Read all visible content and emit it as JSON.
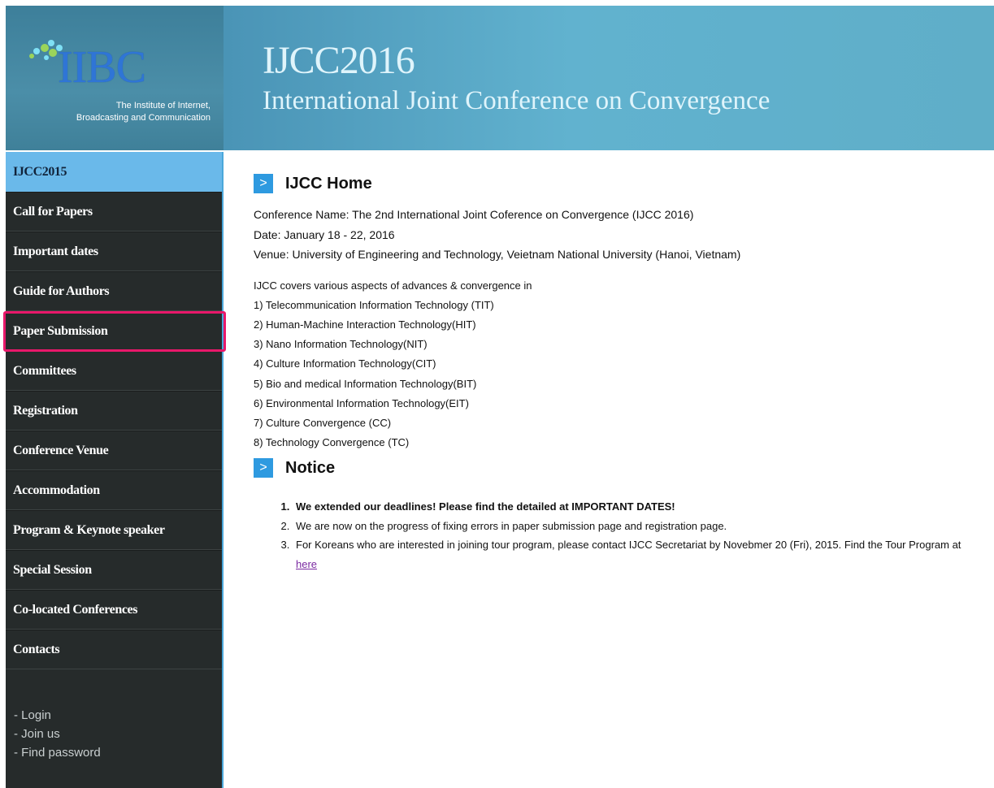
{
  "logo": {
    "name": "IIBC",
    "subtitle_line1": "The Institute of Internet,",
    "subtitle_line2": "Broadcasting and Communication"
  },
  "banner": {
    "title": "IJCC2016",
    "subtitle": "International Joint Conference on Convergence"
  },
  "sidebar": {
    "items": [
      {
        "label": "IJCC2015"
      },
      {
        "label": "Call for Papers"
      },
      {
        "label": "Important dates"
      },
      {
        "label": "Guide for Authors"
      },
      {
        "label": "Paper Submission"
      },
      {
        "label": "Committees"
      },
      {
        "label": "Registration"
      },
      {
        "label": "Conference Venue"
      },
      {
        "label": "Accommodation"
      },
      {
        "label": "Program & Keynote speaker"
      },
      {
        "label": "Special Session"
      },
      {
        "label": "Co-located Conferences"
      },
      {
        "label": "Contacts"
      }
    ],
    "account": {
      "login": "- Login",
      "join": "- Join us",
      "find_password": "- Find password"
    }
  },
  "main": {
    "home_title": "IJCC Home",
    "conference_name": "Conference Name: The 2nd International Joint Coference on Convergence (IJCC 2016)",
    "date": "Date: January 18 - 22, 2016",
    "venue": "Venue: University of Engineering and Technology, Veietnam National University (Hanoi, Vietnam)",
    "covers_intro": "IJCC covers various aspects of advances & convergence in",
    "topics": [
      "1) Telecommunication Information Technology (TIT)",
      "2) Human-Machine Interaction Technology(HIT)",
      "3) Nano Information Technology(NIT)",
      "4) Culture Information Technology(CIT)",
      "5) Bio and medical Information Technology(BIT)",
      "6) Environmental Information Technology(EIT)",
      "7) Culture Convergence (CC)",
      "8) Technology Convergence (TC)"
    ],
    "notice_title": "Notice",
    "notices": {
      "n1": "We extended our deadlines! Please find the detailed at IMPORTANT DATES!",
      "n2": "We are now on the progress of fixing errors in paper submission page and registration page.",
      "n3": "For Koreans who are interested in joining tour program, please contact IJCC Secretariat by Novebmer 20 (Fri), 2015. Find the Tour Program at ",
      "n3_link": "here"
    },
    "arrow_glyph": ">"
  },
  "colors": {
    "sidebar_bg": "#262b2b",
    "active_item": "#6ab9ea",
    "highlight_border": "#e8186a",
    "accent_blue": "#2e9ae0"
  }
}
